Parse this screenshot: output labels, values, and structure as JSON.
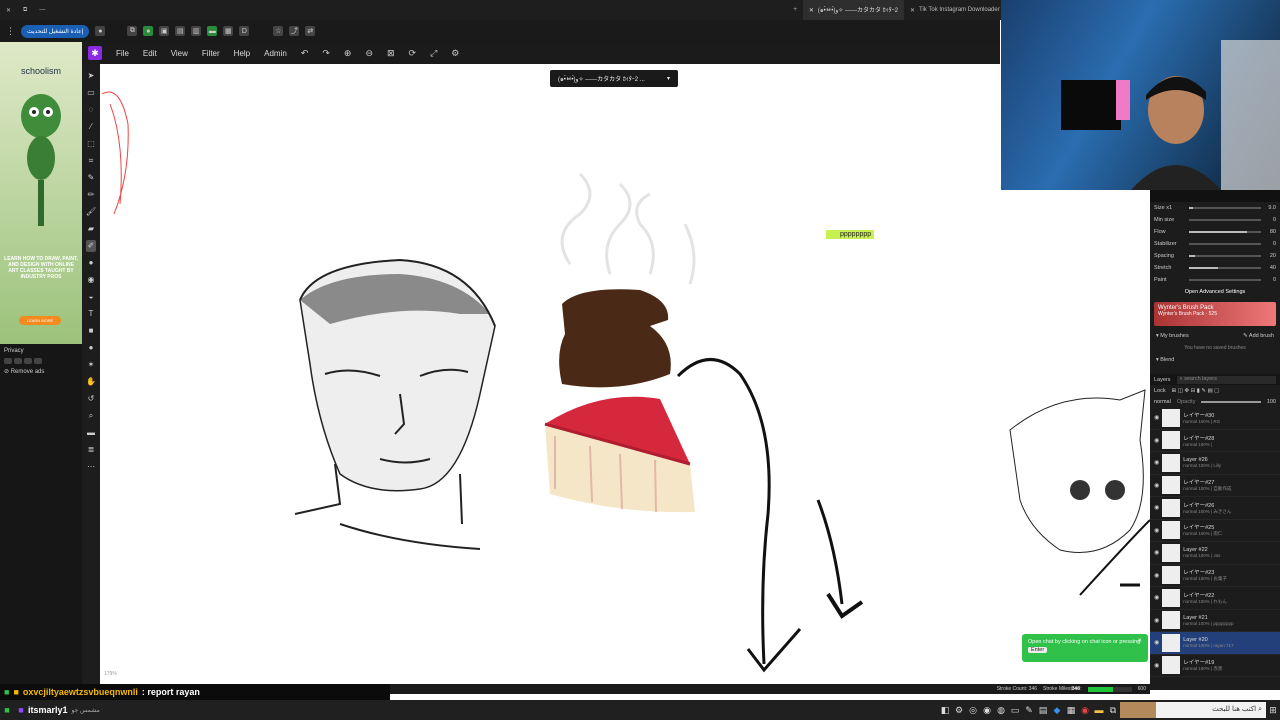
{
  "browser": {
    "tabs": [
      {
        "label": "(๑•̀ㅂ•́)و✧ ——カタカタ ｶｨﾀｰ2",
        "active": true
      },
      {
        "label": "Tik Tok Instagram Downloader",
        "active": false
      }
    ],
    "update_button": "إعادة التشغيل للتحديث"
  },
  "app": {
    "menu": [
      "File",
      "Edit",
      "View",
      "Filter",
      "Help",
      "Admin"
    ],
    "document_title": "(๑•̀ㅂ•́)و✧ ——カタカタ ｶｨﾀｰ2 ...",
    "cursor_label": "pppppppp",
    "zoom_text": "179%",
    "status": {
      "stroke_count_label": "Stroke Count: 346",
      "stroke_milestone_label": "Stroke Milestone:",
      "milestone_current": "346",
      "milestone_target": "600",
      "milestone_fraction": 0.58
    }
  },
  "ad": {
    "brand": "schoolism",
    "text": "LEARN HOW TO DRAW, PAINT, AND DESIGN WITH ONLINE ART CLASSES TAUGHT BY INDUSTRY PROS",
    "cta": "LEARN MORE",
    "privacy": "Privacy",
    "remove_ads": "Remove ads"
  },
  "brush_settings": {
    "sliders": [
      {
        "label": "Size x1",
        "value": "9.0",
        "fraction": 0.05
      },
      {
        "label": "Min size",
        "value": "0",
        "fraction": 0.0
      },
      {
        "label": "Flow",
        "value": "80",
        "fraction": 0.8
      },
      {
        "label": "Stabilizer",
        "value": "0",
        "fraction": 0.0
      },
      {
        "label": "Spacing",
        "value": "20",
        "fraction": 0.08
      },
      {
        "label": "Stretch",
        "value": "40",
        "fraction": 0.4
      },
      {
        "label": "Paint",
        "value": "0",
        "fraction": 0.0
      }
    ],
    "advanced_button": "Open Advanced Settings",
    "brush_pack_title": "Wynter's Brush Pack",
    "brush_pack_sub": "Wynter's Brush Pack · 525",
    "my_brushes": "My brushes",
    "add_brush": "Add brush",
    "no_saved": "You have no saved brushes",
    "blend": "Blend"
  },
  "layers": {
    "title": "Layers",
    "search_placeholder": "search layers",
    "lock_label": "Lock",
    "blend_mode": "normal",
    "opacity_label": "Opacity",
    "opacity_value": "100",
    "items": [
      {
        "name": "レイヤー#30",
        "sub": "normal 100% | RG"
      },
      {
        "name": "レイヤー#28",
        "sub": "normal 100% |"
      },
      {
        "name": "Layer #26",
        "sub": "normal 100% | Lilly"
      },
      {
        "name": "レイヤー#27",
        "sub": "normal 100% | 自動作成"
      },
      {
        "name": "レイヤー#26",
        "sub": "normal 100% | みきさん"
      },
      {
        "name": "レイヤー#25",
        "sub": "normal 100% | 雨仁"
      },
      {
        "name": "Layer #22",
        "sub": "normal 100% | Jas"
      },
      {
        "name": "レイヤー#23",
        "sub": "normal 100% | お菓子"
      },
      {
        "name": "レイヤー#22",
        "sub": "normal 100% | れもん"
      },
      {
        "name": "Layer #21",
        "sub": "normal 100% | pppppppp"
      },
      {
        "name": "Layer #20",
        "sub": "normal 100% | rayan 717",
        "selected": true
      },
      {
        "name": "レイヤー#19",
        "sub": "normal 100% | 赤黒"
      }
    ]
  },
  "chat_popup": {
    "text": "Open chat by clicking on chat icon or pressing",
    "key": "Enter"
  },
  "stream_chat": {
    "user": "oxvcjiltyaewtzsvbueqnwnli",
    "message": ": report rayan",
    "user2": "itsmarly1",
    "message2": "مشمس جو"
  },
  "taskbar": {
    "search_text": "اكتب هنا للبحث"
  }
}
